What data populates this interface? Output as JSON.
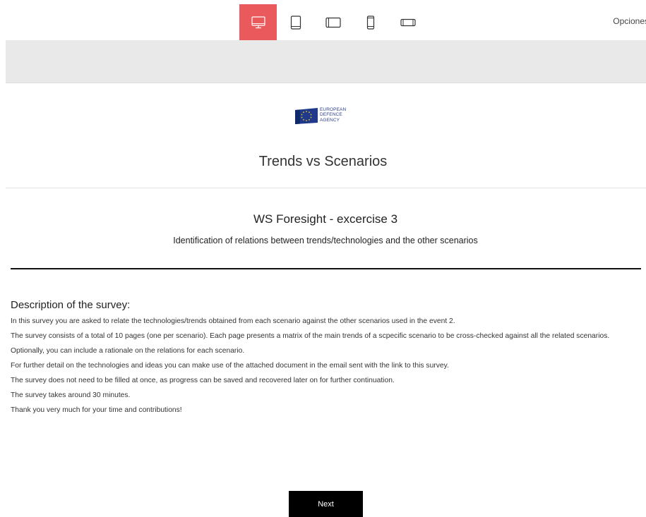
{
  "toolbar": {
    "devices": [
      {
        "icon": "desktop-icon",
        "active": true
      },
      {
        "icon": "tablet-portrait-icon",
        "active": false
      },
      {
        "icon": "tablet-landscape-icon",
        "active": false
      },
      {
        "icon": "phone-portrait-icon",
        "active": false
      },
      {
        "icon": "phone-landscape-icon",
        "active": false
      }
    ],
    "options_label": "Opciones",
    "active_color": "#ea5a5c"
  },
  "header": {
    "logo_lines": [
      "EUROPEAN",
      "DEFENCE",
      "AGENCY"
    ],
    "survey_title": "Trends vs Scenarios"
  },
  "group": {
    "title": "WS Foresight - excercise 3",
    "subtitle": "Identification of relations between trends/technologies and the other scenarios"
  },
  "description": {
    "heading": "Description of the survey:",
    "paragraphs": [
      "In this survey you are asked to relate the technologies/trends obtained from each scenario against the other scenarios used in the event 2.",
      "The survey consists of a total of 10 pages (one per scenario).  Each page presents a matrix of the main trends of a scpecific scenario to be cross-checked against all the related scenarios.",
      "Optionally, you can include a rationale on the relations for each scenario.",
      "For further detail on the technologies and ideas you can make use of the attached document in the email sent with the link to this survey.",
      "The survey does not need to be filled at once, as progress can be saved and recovered later on for further continuation.",
      "The survey takes around 30 minutes.",
      "Thank you very much for your time and contributions!"
    ]
  },
  "footer": {
    "next_label": "Next"
  }
}
